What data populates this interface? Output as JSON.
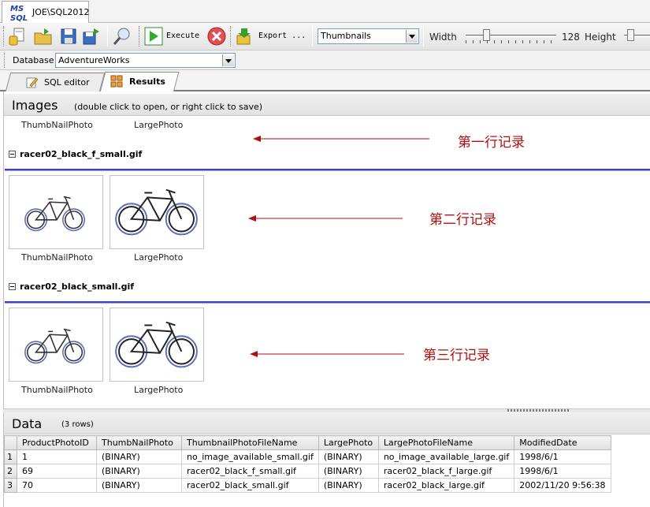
{
  "window_tab": {
    "logo_top": "MS",
    "logo_bottom": "SQL",
    "title": "JOE\\SQL2012"
  },
  "toolbar": {
    "execute_label": "Execute",
    "export_label": "Export ...",
    "view_mode": "Thumbnails",
    "width_label": "Width",
    "width_value": "128",
    "height_label": "Height"
  },
  "database": {
    "label": "Database",
    "value": "AdventureWorks"
  },
  "editor_tabs": [
    {
      "label": "SQL editor"
    },
    {
      "label": "Results"
    }
  ],
  "images": {
    "title": "Images",
    "subtitle": "(double click to open, or right click to save)",
    "columns": [
      "ThumbNailPhoto",
      "LargePhoto"
    ],
    "groups": [
      {
        "title": "racer02_black_f_small.gif"
      },
      {
        "title": "racer02_black_small.gif"
      }
    ],
    "annotations": [
      "第一行记录",
      "第二行记录",
      "第三行记录"
    ]
  },
  "data": {
    "title": "Data",
    "rows_note": "(3 rows)",
    "columns": [
      "ProductPhotoID",
      "ThumbNailPhoto",
      "ThumbnailPhotoFileName",
      "LargePhoto",
      "LargePhotoFileName",
      "ModifiedDate"
    ],
    "rows": [
      {
        "num": "1",
        "cells": [
          "1",
          "(BINARY)",
          "no_image_available_small.gif",
          "(BINARY)",
          "no_image_available_large.gif",
          "1998/6/1"
        ]
      },
      {
        "num": "2",
        "cells": [
          "69",
          "(BINARY)",
          "racer02_black_f_small.gif",
          "(BINARY)",
          "racer02_black_f_large.gif",
          "1998/6/1"
        ]
      },
      {
        "num": "3",
        "cells": [
          "70",
          "(BINARY)",
          "racer02_black_small.gif",
          "(BINARY)",
          "racer02_black_large.gif",
          "2002/11/20 9:56:38"
        ]
      }
    ]
  },
  "colors": {
    "group_line": "#3d43c4",
    "annotation": "#b01010"
  }
}
